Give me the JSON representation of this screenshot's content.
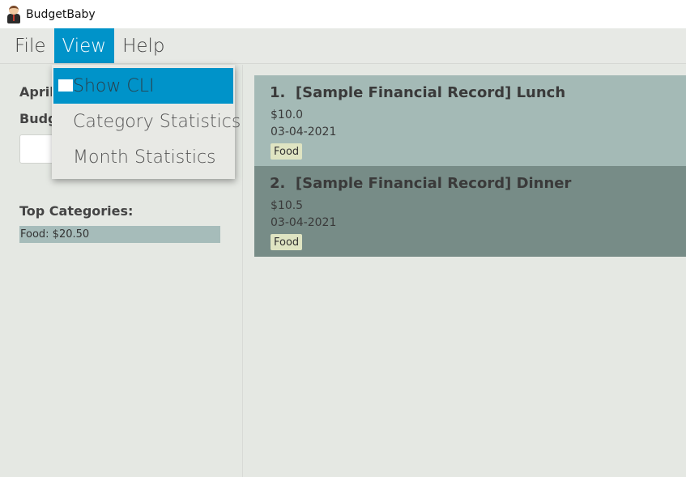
{
  "window": {
    "title": "BudgetBaby",
    "icon": "boss-baby-icon"
  },
  "menubar": {
    "items": [
      "File",
      "View",
      "Help"
    ],
    "active": "View"
  },
  "view_menu": {
    "items": [
      "Show CLI",
      "Category Statistics",
      "Month Statistics"
    ],
    "highlighted": "Show CLI"
  },
  "left_panel": {
    "month_label": "April",
    "budget_label": "Budg",
    "top_categories_label": "Top Categories:",
    "categories": [
      {
        "text": "Food: $20.50"
      }
    ]
  },
  "records": [
    {
      "index": "1.",
      "title": "[Sample Financial Record] Lunch",
      "amount": "$10.0",
      "date": "03-04-2021",
      "tag": "Food"
    },
    {
      "index": "2.",
      "title": "[Sample Financial Record] Dinner",
      "amount": "$10.5",
      "date": "03-04-2021",
      "tag": "Food"
    }
  ],
  "colors": {
    "accent": "#0093c9",
    "card_light": "#a4bab6",
    "card_dark": "#778c87",
    "background": "#e5e8e3",
    "tag": "#dfe4c2"
  }
}
